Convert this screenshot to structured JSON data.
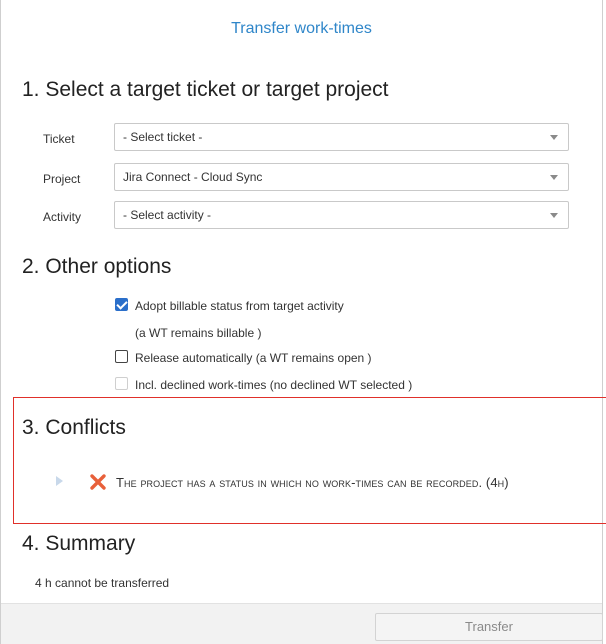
{
  "dialog": {
    "title": "Transfer work-times"
  },
  "sections": {
    "target": {
      "heading": "1. Select a target ticket or target project",
      "fields": {
        "ticket": {
          "label": "Ticket",
          "value": "- Select ticket -"
        },
        "project": {
          "label": "Project",
          "value": "Jira Connect - Cloud Sync"
        },
        "activity": {
          "label": "Activity",
          "value": "- Select activity -"
        }
      }
    },
    "options": {
      "heading": "2. Other options",
      "adopt_billable": {
        "label": "Adopt billable status from target activity",
        "note": "(a WT remains billable )",
        "checked": true
      },
      "release_auto": {
        "label": "Release automatically (a WT remains open )",
        "checked": false
      },
      "incl_declined": {
        "label": "Incl. declined work-times (no declined WT selected )",
        "checked": false,
        "disabled": true
      }
    },
    "conflicts": {
      "heading": "3. Conflicts",
      "items": [
        {
          "icon": "error-x-icon",
          "text": "The project has a status in which no work-times can be recorded. (4h)"
        }
      ]
    },
    "summary": {
      "heading": "4. Summary",
      "text": "4 h cannot be transferred"
    }
  },
  "footer": {
    "transfer_label": "Transfer"
  },
  "colors": {
    "title_blue": "#2f86c9",
    "checkbox_blue": "#2b6fca",
    "conflict_border": "#e0302a",
    "error_icon": "#e8603a"
  }
}
